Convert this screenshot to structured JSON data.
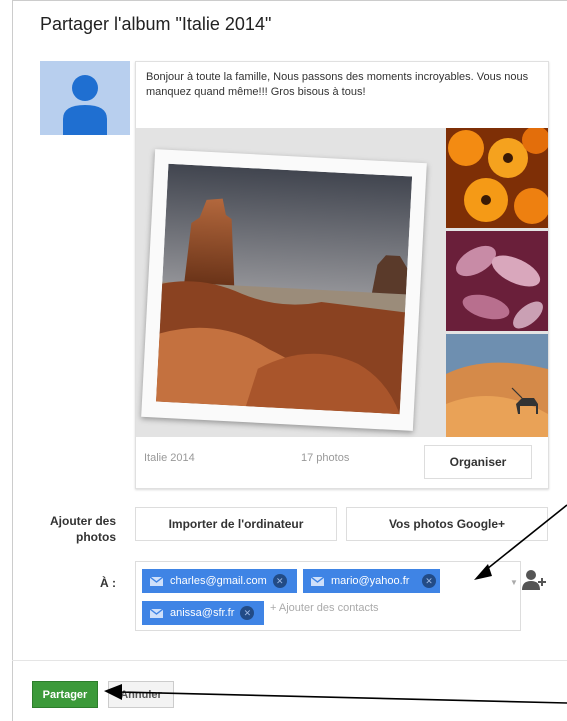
{
  "dialog": {
    "title": "Partager l'album \"Italie 2014\""
  },
  "post": {
    "message": "Bonjour à toute la famille, Nous passons des moments incroyables. Vous nous manquez quand même!!! Gros bisous à tous!"
  },
  "album": {
    "name": "Italie 2014",
    "count": "17 photos",
    "organize_label": "Organiser"
  },
  "add_photos": {
    "label": "Ajouter des photos",
    "import_label": "Importer de l'ordinateur",
    "google_label": "Vos photos Google+"
  },
  "recipients": {
    "label": "À :",
    "chips": [
      "charles@gmail.com",
      "mario@yahoo.fr",
      "anissa@sfr.fr"
    ],
    "placeholder": "+ Ajouter des contacts"
  },
  "actions": {
    "share_label": "Partager",
    "cancel_label": "Annuler"
  },
  "colors": {
    "chip": "#3f84e5",
    "share": "#3c9a3a"
  },
  "icons": [
    "person-icon",
    "mail-icon",
    "remove-icon",
    "dropdown-icon",
    "add-person-icon"
  ]
}
